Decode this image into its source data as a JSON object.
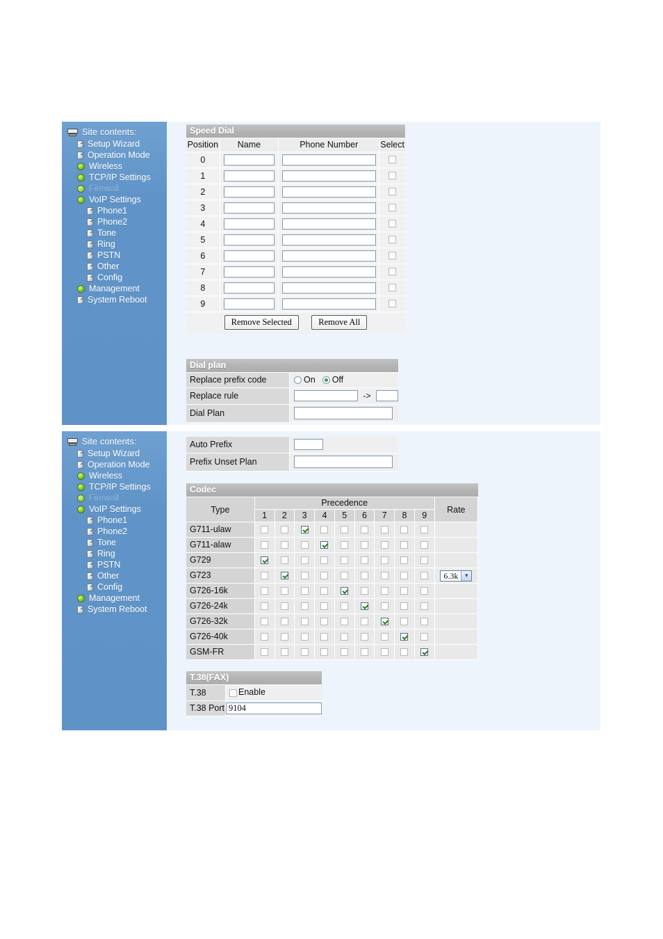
{
  "sidebar": {
    "header": "Site contents:",
    "header_icon": "computer-icon",
    "items": [
      {
        "label": "Setup Wizard",
        "icon": "page-icon",
        "level": 1,
        "dim": false
      },
      {
        "label": "Operation Mode",
        "icon": "page-icon",
        "level": 1,
        "dim": false
      },
      {
        "label": "Wireless",
        "icon": "bullet-icon",
        "level": 1,
        "dim": false
      },
      {
        "label": "TCP/IP Settings",
        "icon": "bullet-icon",
        "level": 1,
        "dim": false
      },
      {
        "label": "Firewall",
        "icon": "bullet-icon",
        "level": 1,
        "dim": true
      },
      {
        "label": "VoIP Settings",
        "icon": "bullet-icon",
        "level": 1,
        "dim": false
      },
      {
        "label": "Phone1",
        "icon": "page-icon",
        "level": 2,
        "dim": false
      },
      {
        "label": "Phone2",
        "icon": "page-icon",
        "level": 2,
        "dim": false
      },
      {
        "label": "Tone",
        "icon": "page-icon",
        "level": 2,
        "dim": false
      },
      {
        "label": "Ring",
        "icon": "page-icon",
        "level": 2,
        "dim": false
      },
      {
        "label": "PSTN",
        "icon": "page-icon",
        "level": 2,
        "dim": false
      },
      {
        "label": "Other",
        "icon": "page-icon",
        "level": 2,
        "dim": false
      },
      {
        "label": "Config",
        "icon": "page-icon",
        "level": 2,
        "dim": false
      },
      {
        "label": "Management",
        "icon": "bullet-icon",
        "level": 1,
        "dim": false
      },
      {
        "label": "System Reboot",
        "icon": "page-icon",
        "level": 1,
        "dim": false
      }
    ]
  },
  "speed_dial": {
    "title": "Speed Dial",
    "columns": [
      "Position",
      "Name",
      "Phone Number",
      "Select"
    ],
    "rows": [
      {
        "position": "0",
        "name": "",
        "phone": "",
        "selected": false
      },
      {
        "position": "1",
        "name": "",
        "phone": "",
        "selected": false
      },
      {
        "position": "2",
        "name": "",
        "phone": "",
        "selected": false
      },
      {
        "position": "3",
        "name": "",
        "phone": "",
        "selected": false
      },
      {
        "position": "4",
        "name": "",
        "phone": "",
        "selected": false
      },
      {
        "position": "5",
        "name": "",
        "phone": "",
        "selected": false
      },
      {
        "position": "6",
        "name": "",
        "phone": "",
        "selected": false
      },
      {
        "position": "7",
        "name": "",
        "phone": "",
        "selected": false
      },
      {
        "position": "8",
        "name": "",
        "phone": "",
        "selected": false
      },
      {
        "position": "9",
        "name": "",
        "phone": "",
        "selected": false
      }
    ],
    "remove_selected_label": "Remove Selected",
    "remove_all_label": "Remove All"
  },
  "dial_plan": {
    "title": "Dial plan",
    "replace_prefix_label": "Replace prefix code",
    "radio_on_label": "On",
    "radio_off_label": "Off",
    "replace_prefix_value": "Off",
    "replace_rule_label": "Replace rule",
    "replace_rule_from": "",
    "replace_rule_arrow": "->",
    "replace_rule_to": "",
    "dial_plan_label": "Dial Plan",
    "dial_plan_value": ""
  },
  "prefix": {
    "auto_prefix_label": "Auto Prefix",
    "auto_prefix_value": "",
    "prefix_unset_label": "Prefix Unset Plan",
    "prefix_unset_value": ""
  },
  "codec": {
    "title": "Codec",
    "type_header": "Type",
    "precedence_header": "Precedence",
    "rate_header": "Rate",
    "precedence_numbers": [
      "1",
      "2",
      "3",
      "4",
      "5",
      "6",
      "7",
      "8",
      "9"
    ],
    "rows": [
      {
        "type": "G711-ulaw",
        "checked": 3,
        "rate": null
      },
      {
        "type": "G711-alaw",
        "checked": 4,
        "rate": null
      },
      {
        "type": "G729",
        "checked": 1,
        "rate": null
      },
      {
        "type": "G723",
        "checked": 2,
        "rate": "6.3k"
      },
      {
        "type": "G726-16k",
        "checked": 5,
        "rate": null
      },
      {
        "type": "G726-24k",
        "checked": 6,
        "rate": null
      },
      {
        "type": "G726-32k",
        "checked": 7,
        "rate": null
      },
      {
        "type": "G726-40k",
        "checked": 8,
        "rate": null
      },
      {
        "type": "GSM-FR",
        "checked": 9,
        "rate": null
      }
    ]
  },
  "t38": {
    "title": "T.38(FAX)",
    "t38_label": "T.38",
    "enable_label": "Enable",
    "enabled": false,
    "port_label": "T.38 Port",
    "port_value": "9104"
  },
  "colors": {
    "sidebar_blue": "#6094c8",
    "panel_bg": "#edf4fc",
    "section_bar": "#b4b4b4",
    "check_green": "#2e7d1e",
    "radio_green": "#35a035"
  }
}
